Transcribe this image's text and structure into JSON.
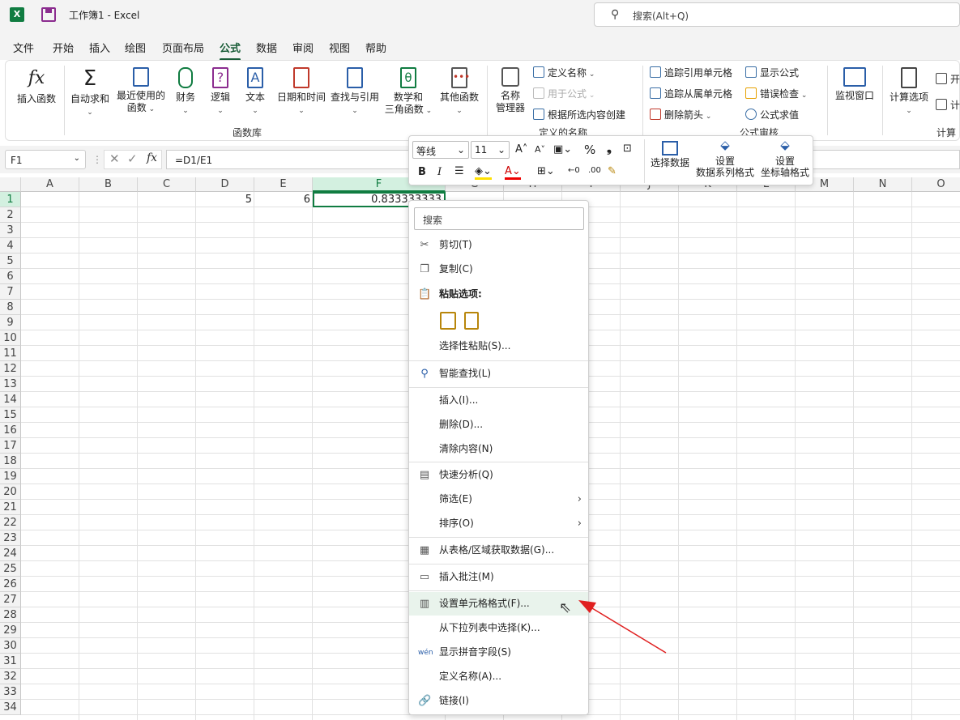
{
  "window": {
    "title": "工作簿1  -  Excel"
  },
  "search": {
    "placeholder": "搜索(Alt+Q)"
  },
  "menu_tabs": [
    "文件",
    "开始",
    "插入",
    "绘图",
    "页面布局",
    "公式",
    "数据",
    "审阅",
    "视图",
    "帮助"
  ],
  "active_tab": "公式",
  "ribbon": {
    "insert_function": "插入函数",
    "autosum": "自动求和",
    "recent_1": "最近使用的",
    "recent_2": "函数",
    "financial": "财务",
    "logical": "逻辑",
    "text": "文本",
    "datetime": "日期和时间",
    "lookup": "查找与引用",
    "math_1": "数学和",
    "math_2": "三角函数",
    "more": "其他函数",
    "group_library": "函数库",
    "name_mgr_1": "名称",
    "name_mgr_2": "管理器",
    "define_name": "定义名称",
    "use_in_formula": "用于公式",
    "create_from_sel": "根据所选内容创建",
    "group_defined": "定义的名称",
    "trace_prec": "追踪引用单元格",
    "trace_dep": "追踪从属单元格",
    "remove_arrows": "删除箭头",
    "show_formulas": "显示公式",
    "error_check": "错误检查",
    "eval_formula": "公式求值",
    "group_audit": "公式审核",
    "watch": "监视窗口",
    "calc_options": "计算选项",
    "calc_now": "开",
    "calc_sheet": "计",
    "group_calc": "计算",
    "fx_glyph": "fx",
    "sigma_glyph": "Σ"
  },
  "formula_bar": {
    "name_box": "F1",
    "fx": "fx",
    "formula": "=D1/E1"
  },
  "columns": [
    "A",
    "B",
    "C",
    "D",
    "E",
    "F",
    "G",
    "H",
    "I",
    "J",
    "K",
    "L",
    "M",
    "N",
    "O"
  ],
  "rows": [
    "1",
    "2",
    "3",
    "4",
    "5",
    "6",
    "7",
    "8",
    "9",
    "10",
    "11",
    "12",
    "13",
    "14",
    "15",
    "16",
    "17",
    "18",
    "19",
    "20",
    "21",
    "22",
    "23",
    "24",
    "25",
    "26",
    "27",
    "28",
    "29",
    "30",
    "31",
    "32",
    "33",
    "34"
  ],
  "cells": {
    "D1": "5",
    "E1": "6",
    "F1": "0.833333333"
  },
  "mini_toolbar": {
    "font": "等线",
    "size": "11",
    "select_data": "选择数据",
    "series_fmt_1": "设置",
    "series_fmt_2": "数据系列格式",
    "axis_fmt_1": "设置",
    "axis_fmt_2": "坐标轴格式",
    "bold": "B",
    "italic": "I",
    "percent": "%",
    "comma": "❟"
  },
  "context_menu": {
    "search": "搜索",
    "cut": "剪切(T)",
    "copy": "复制(C)",
    "paste_options": "粘贴选项:",
    "paste_special": "选择性粘贴(S)...",
    "smart_lookup": "智能查找(L)",
    "insert": "插入(I)...",
    "delete": "删除(D)...",
    "clear": "清除内容(N)",
    "quick_analysis": "快速分析(Q)",
    "filter": "筛选(E)",
    "sort": "排序(O)",
    "get_data": "从表格/区域获取数据(G)...",
    "insert_comment": "插入批注(M)",
    "format_cells": "设置单元格格式(F)...",
    "pick_list": "从下拉列表中选择(K)...",
    "phonetic": "显示拼音字段(S)",
    "define_name": "定义名称(A)...",
    "link": "链接(I)"
  },
  "colors": {
    "accent": "#107c41",
    "arrow": "#e02020"
  }
}
